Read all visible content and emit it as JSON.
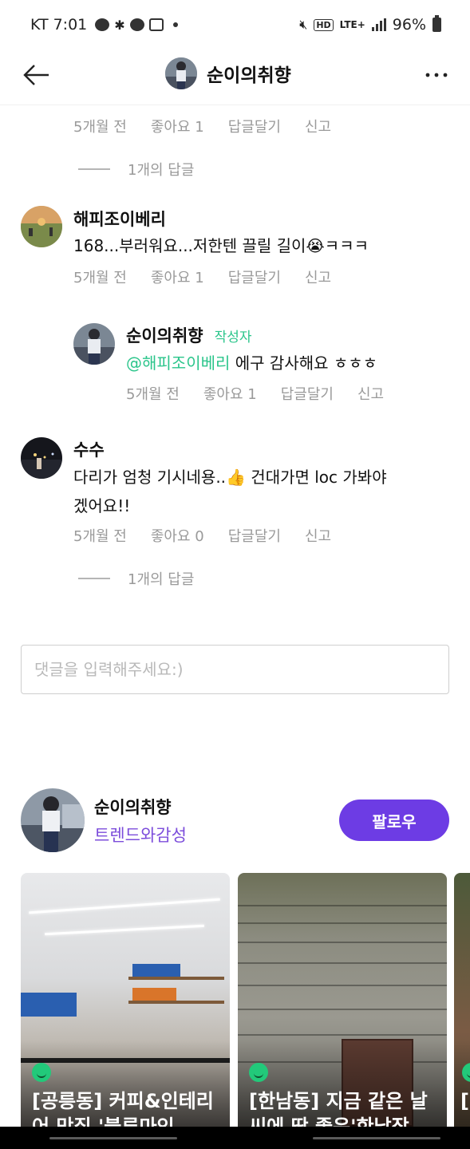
{
  "status_bar": {
    "carrier": "KT",
    "time": "7:01",
    "battery": "96%",
    "network": "LTE+"
  },
  "header": {
    "title": "순이의취향"
  },
  "comments": [
    {
      "meta": {
        "time": "5개월 전",
        "likes": "좋아요 1",
        "reply": "답글달기",
        "report": "신고"
      },
      "replies_toggle": "1개의 답글"
    },
    {
      "author": "해피조이베리",
      "text": "168...부러워요...저한텐 끌릴 길이😭ㅋㅋㅋ",
      "meta": {
        "time": "5개월 전",
        "likes": "좋아요 1",
        "reply": "답글달기",
        "report": "신고"
      },
      "replies": [
        {
          "author": "순이의취향",
          "author_tag": "작성자",
          "mention": "@해피조이베리",
          "text": " 에구 감사해요 ㅎㅎㅎ",
          "meta": {
            "time": "5개월 전",
            "likes": "좋아요 1",
            "reply": "답글달기",
            "report": "신고"
          }
        }
      ]
    },
    {
      "author": "수수",
      "text_line1": "다리가 엄청 기시네용..👍 건대가면 loc 가봐야",
      "text_line2": "겠어요!!",
      "meta": {
        "time": "5개월 전",
        "likes": "좋아요 0",
        "reply": "답글달기",
        "report": "신고"
      },
      "replies_toggle": "1개의 답글"
    }
  ],
  "comment_input": {
    "placeholder": "댓글을 입력해주세요:)"
  },
  "profile": {
    "name": "순이의취향",
    "category": "트렌드와감성",
    "follow_label": "팔로우"
  },
  "posts": [
    {
      "title": "[공릉동] 커피&인테리어 맛집 '블루마인"
    },
    {
      "title": "[한남동] 지금 같은 날씨에 딱 좋은'한남작"
    },
    {
      "title": "["
    }
  ],
  "colors": {
    "accent_green": "#2bc58b",
    "follow_purple": "#6d3ce4",
    "category_purple": "#7c4ddb",
    "meta_gray": "#9a9a9a"
  }
}
